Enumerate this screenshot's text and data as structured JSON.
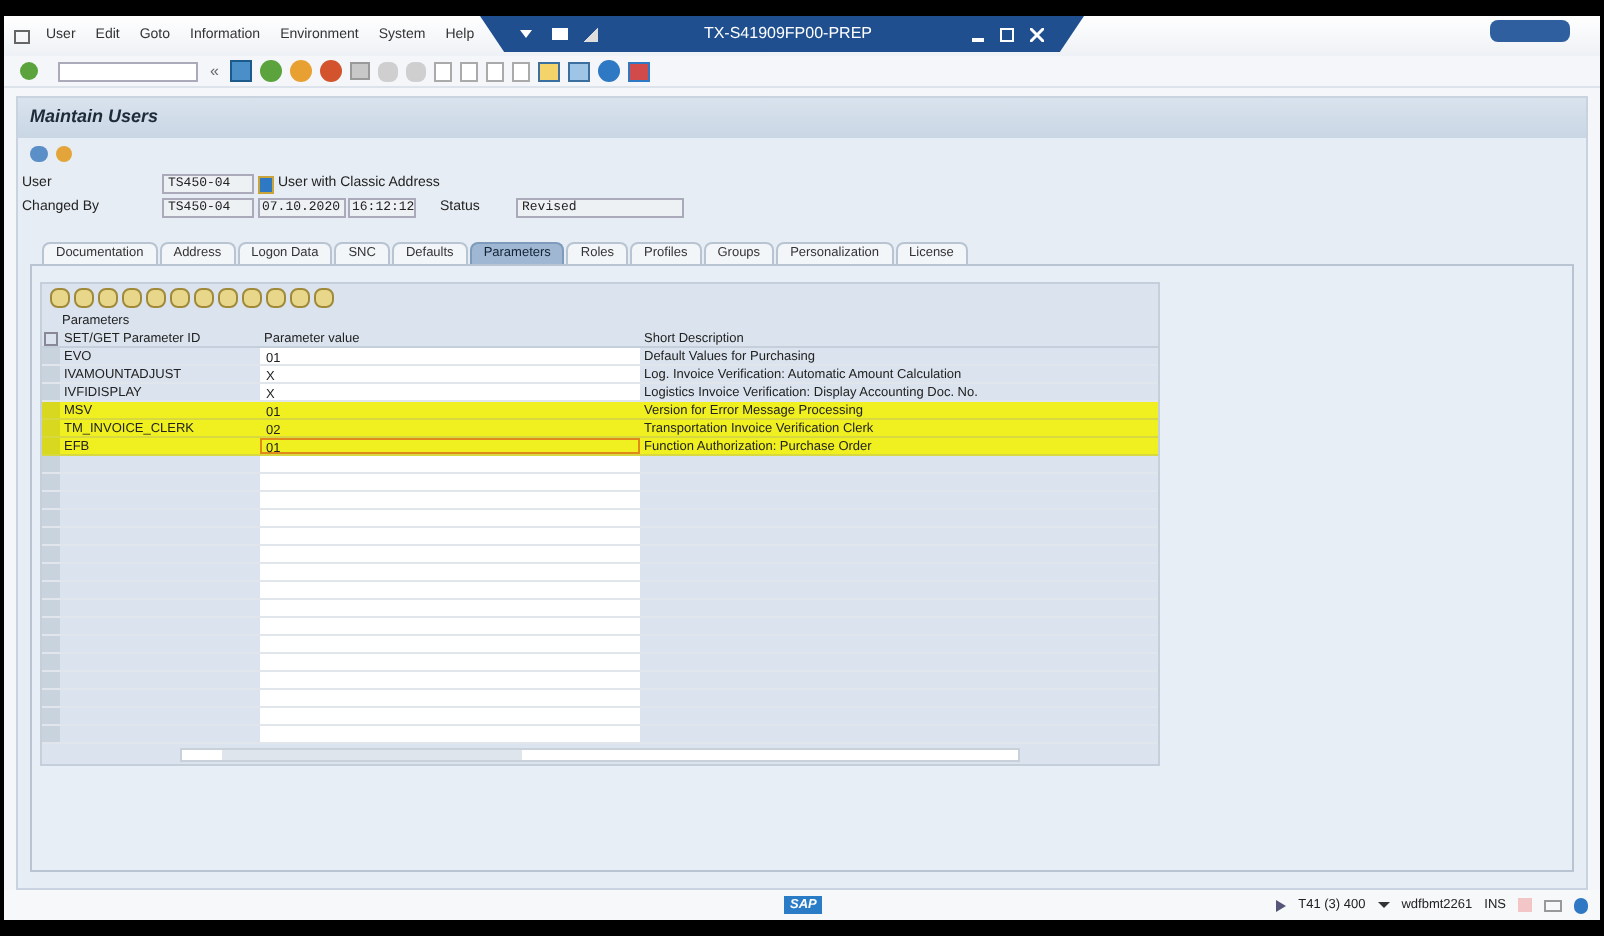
{
  "menu": [
    "User",
    "Edit",
    "Goto",
    "Information",
    "Environment",
    "System",
    "Help"
  ],
  "window": {
    "title": "TX-S41909FP00-PREP"
  },
  "toolbar": {
    "collapse": "«"
  },
  "screen_title": "Maintain Users",
  "fields": [
    {
      "label": "User",
      "value": "TS450-04",
      "note": "User with Classic Address"
    },
    {
      "label": "Changed By",
      "value": "TS450-04",
      "date": "07.10.2020",
      "time": "16:12:12",
      "status_label": "Status",
      "status": "Revised"
    }
  ],
  "tabs": [
    {
      "label": "Documentation",
      "selected": false
    },
    {
      "label": "Address",
      "selected": false
    },
    {
      "label": "Logon Data",
      "selected": false
    },
    {
      "label": "SNC",
      "selected": false
    },
    {
      "label": "Defaults",
      "selected": false
    },
    {
      "label": "Parameters",
      "selected": true
    },
    {
      "label": "Roles",
      "selected": false
    },
    {
      "label": "Profiles",
      "selected": false
    },
    {
      "label": "Groups",
      "selected": false
    },
    {
      "label": "Personalization",
      "selected": false
    },
    {
      "label": "License",
      "selected": false
    }
  ],
  "table": {
    "title": "Parameters",
    "columns": [
      "SET/GET Parameter ID",
      "Parameter value",
      "Short Description"
    ],
    "rows": [
      {
        "id": "EVO",
        "value": "01",
        "description": "Default Values for Purchasing",
        "highlighted": false,
        "focused": false
      },
      {
        "id": "IVAMOUNTADJUST",
        "value": "X",
        "description": "Log. Invoice Verification: Automatic Amount Calculation",
        "highlighted": false,
        "focused": false
      },
      {
        "id": "IVFIDISPLAY",
        "value": "X",
        "description": "Logistics Invoice Verification: Display Accounting Doc. No.",
        "highlighted": false,
        "focused": false
      },
      {
        "id": "MSV",
        "value": "01",
        "description": "Version for Error Message Processing",
        "highlighted": true,
        "focused": false
      },
      {
        "id": "TM_INVOICE_CLERK",
        "value": "02",
        "description": "Transportation Invoice Verification Clerk",
        "highlighted": true,
        "focused": false
      },
      {
        "id": "EFB",
        "value": "01",
        "description": "Function Authorization: Purchase Order",
        "highlighted": true,
        "focused": true
      }
    ]
  },
  "status_bar": {
    "system": "T41 (3) 400",
    "server": "wdfbmt2261",
    "mode": "INS",
    "logo": "SAP"
  }
}
